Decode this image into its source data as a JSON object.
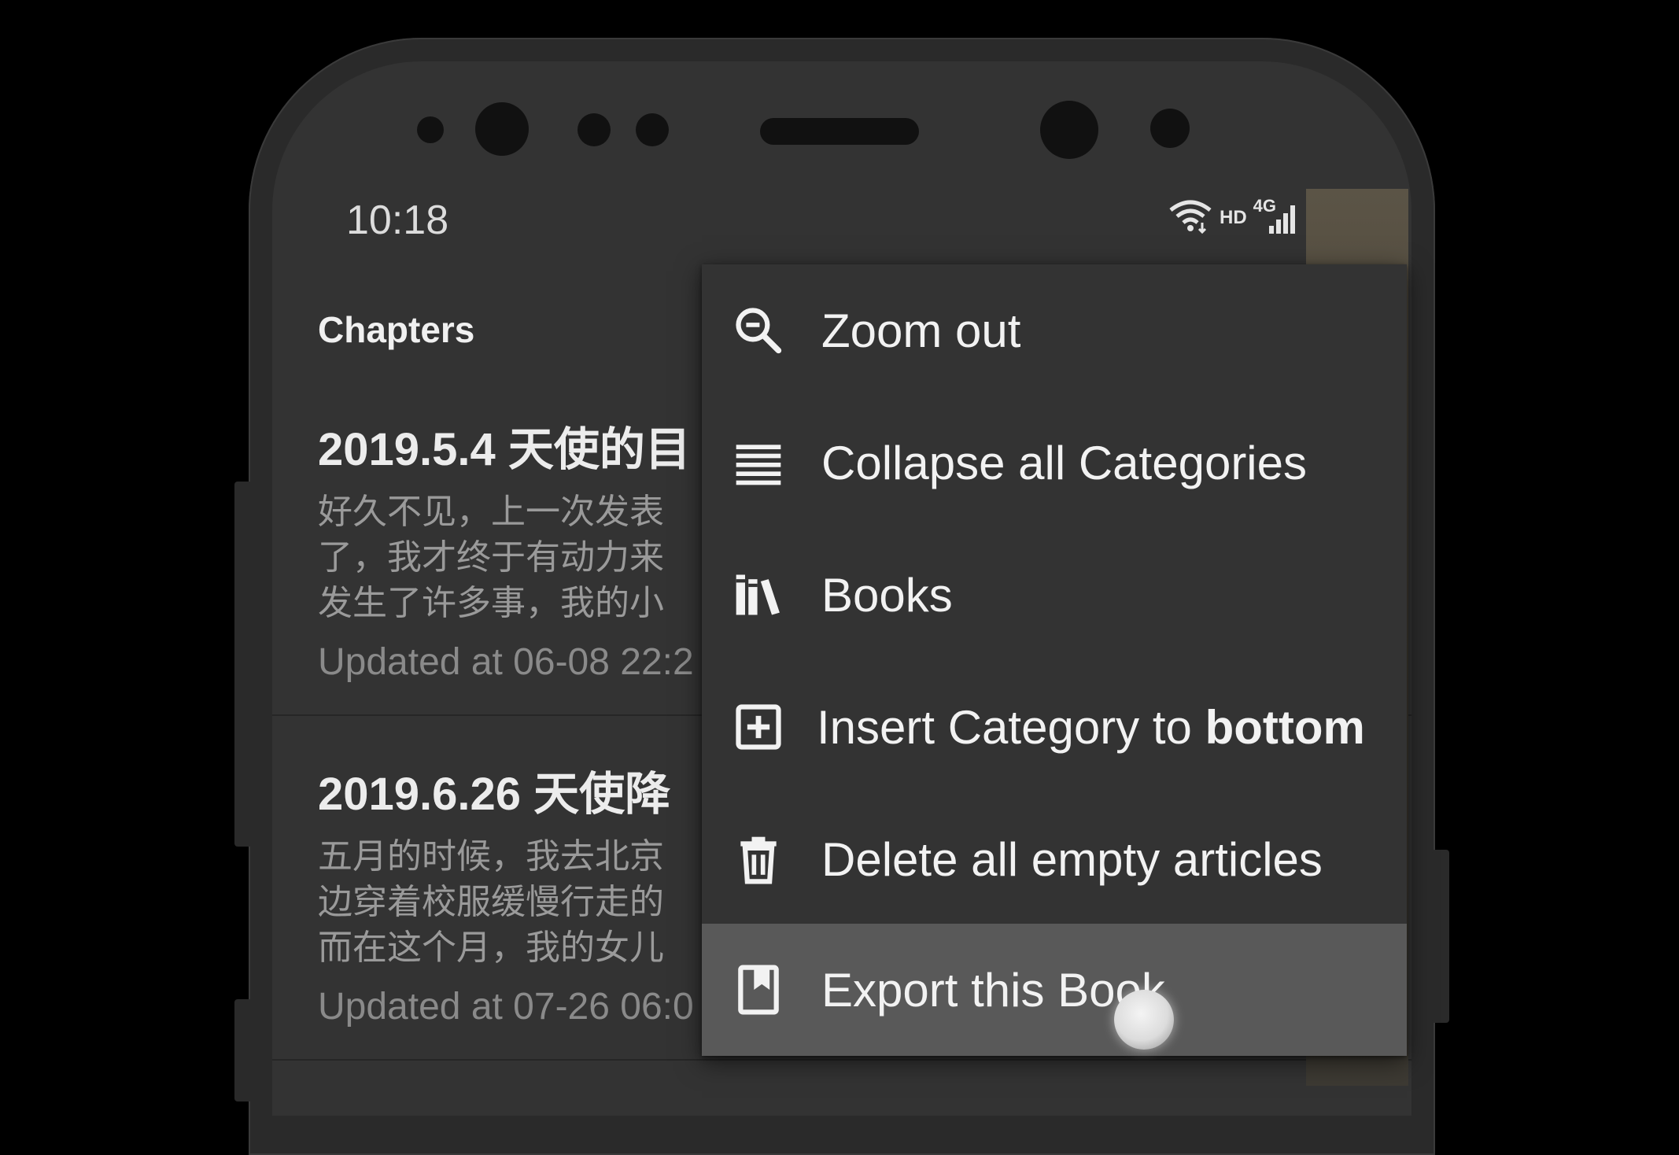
{
  "status_bar": {
    "time": "10:18",
    "network_label": "HD",
    "signal_label": "4G",
    "icons": [
      "wifi-icon",
      "signal-icon",
      "battery-charging-icon"
    ]
  },
  "header": {
    "title": "Chapters"
  },
  "chapters": [
    {
      "title": "2019.5.4 天使的目",
      "lines": [
        "好久不见，上一次发表",
        "了，我才终于有动力来",
        "发生了许多事，我的小"
      ],
      "updated": "Updated at 06-08 22:2"
    },
    {
      "title": "2019.6.26 天使降",
      "lines": [
        "五月的时候，我去北京",
        "边穿着校服缓慢行走的",
        "而在这个月，我的女儿"
      ],
      "updated": "Updated at 07-26 06:0"
    }
  ],
  "menu": {
    "items": [
      {
        "icon": "zoom-out-icon",
        "label": "Zoom out"
      },
      {
        "icon": "collapse-lines-icon",
        "label": "Collapse all Categories"
      },
      {
        "icon": "books-icon",
        "label": "Books"
      },
      {
        "icon": "add-box-icon",
        "label_prefix": "Insert Category to ",
        "label_bold": "bottom"
      },
      {
        "icon": "trash-icon",
        "label": "Delete all empty articles"
      },
      {
        "icon": "bookmark-icon",
        "label": "Export this Book",
        "highlighted": true
      }
    ]
  },
  "colors": {
    "screen_bg": "#333333",
    "menu_bg": "#333333",
    "menu_highlight": "#595959",
    "text_primary": "#f2f2f2",
    "text_secondary": "#9a9a9a"
  }
}
